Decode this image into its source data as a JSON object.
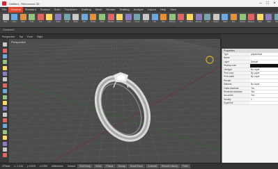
{
  "window": {
    "title": "Untitled - Rhinoceros 3D"
  },
  "menu": {
    "items": [
      "File",
      "General",
      "Standard",
      "Surface",
      "Solid",
      "Transform",
      "Drafting",
      "Mesh",
      "Render",
      "Drafting",
      "Analyze",
      "Layout",
      "Help",
      "View"
    ]
  },
  "ribbon": {
    "buttons": [
      "New",
      "Open",
      "Save",
      "Print",
      "Cut",
      "Copy",
      "Paste",
      "Undo",
      "Redo",
      "Pan",
      "Rotate",
      "Zoom",
      "Window",
      "Extents",
      "Select",
      "Curve",
      "Circle",
      "Arc",
      "Rect",
      "Polygon",
      "Text",
      "Surface",
      "Extrude",
      "Loft",
      "Sweep",
      "Solid",
      "Box",
      "Sphere",
      "Boolean",
      "Fillet",
      "Shell",
      "Mesh",
      "Render",
      "Light",
      "Material",
      "Layer",
      "Props",
      "Snap",
      "Ortho",
      "Planar",
      "Gumball",
      "History",
      "Filter",
      "Grid",
      "Help"
    ]
  },
  "toolstrip": {
    "command_text": "Command:"
  },
  "viewport": {
    "tabs": [
      "Perspective",
      "Top",
      "Front",
      "Right"
    ],
    "label": "Perspective"
  },
  "properties": {
    "header": "Properties",
    "rows": [
      {
        "k": "Type",
        "v": "polysurface"
      },
      {
        "k": "Name",
        "v": ""
      },
      {
        "k": "Layer",
        "v": "Default"
      },
      {
        "k": "Display color",
        "v": ""
      },
      {
        "k": "Linetype",
        "v": "By Layer"
      },
      {
        "k": "Print color",
        "v": "By Layer"
      },
      {
        "k": "Print width",
        "v": "By Layer"
      },
      {
        "k": "Render",
        "v": ""
      },
      {
        "k": "Material",
        "v": "By Layer"
      },
      {
        "k": "Casts shadows",
        "v": "Yes"
      },
      {
        "k": "Receives shadows",
        "v": "Yes"
      },
      {
        "k": "Isocurves",
        "v": "Yes"
      },
      {
        "k": "Density",
        "v": "1"
      },
      {
        "k": "Hyperlink",
        "v": ""
      }
    ]
  },
  "statusbar": {
    "items": [
      "CPlane",
      "x -1.234",
      "y 5.678",
      "z 0.000",
      "Millimeters",
      "Default",
      "Grid Snap",
      "Ortho",
      "Planar",
      "Osnap",
      "SmartTrack",
      "Gumball",
      "Record History",
      "Filter"
    ]
  },
  "colors": {
    "accent": "#e0472f",
    "viewport_bg": "#4a4a4a",
    "panel_bg": "#f4f4f4"
  }
}
